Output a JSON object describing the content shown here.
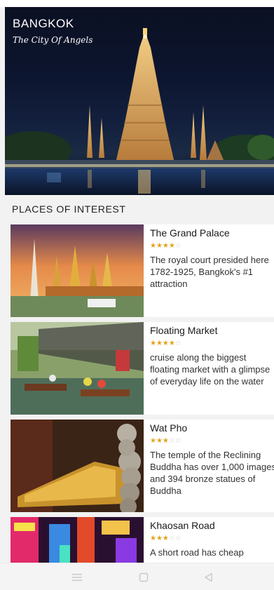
{
  "hero": {
    "title": "BANGKOK",
    "subtitle": "The City Of Angels"
  },
  "section": {
    "title": "PLACES OF INTEREST"
  },
  "places": [
    {
      "name": "The Grand Palace",
      "rating": 4,
      "max_rating": 5,
      "description": "The royal court presided here 1782-1925, Bangkok's #1 attraction"
    },
    {
      "name": "Floating Market",
      "rating": 4,
      "max_rating": 5,
      "description": "cruise along the biggest floating market with a glimpse of everyday life on the water"
    },
    {
      "name": "Wat Pho",
      "rating": 3,
      "max_rating": 5,
      "description": "The temple of the Reclining Buddha has over 1,000 images and 394 bronze statues of Buddha"
    },
    {
      "name": "Khaosan Road",
      "rating": 3,
      "max_rating": 5,
      "description": "A short road has cheap"
    }
  ],
  "navbar": {
    "icons": [
      "menu-icon",
      "home-square-icon",
      "back-triangle-icon"
    ]
  },
  "colors": {
    "star": "#e2a31a",
    "star_off": "#cfcfcf",
    "background": "#f2f2f2"
  }
}
